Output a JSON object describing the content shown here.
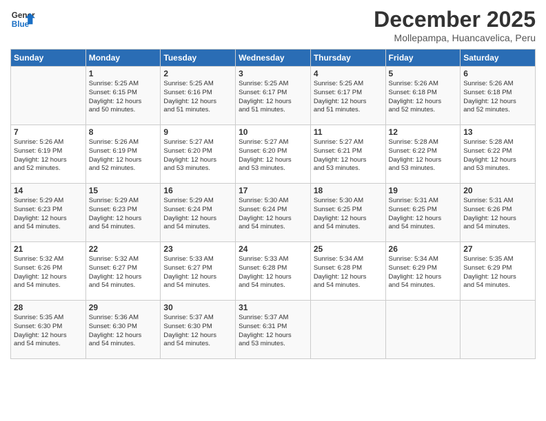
{
  "logo": {
    "line1": "General",
    "line2": "Blue"
  },
  "title": "December 2025",
  "location": "Mollepampa, Huancavelica, Peru",
  "days_of_week": [
    "Sunday",
    "Monday",
    "Tuesday",
    "Wednesday",
    "Thursday",
    "Friday",
    "Saturday"
  ],
  "weeks": [
    [
      {
        "day": "",
        "text": ""
      },
      {
        "day": "1",
        "text": "Sunrise: 5:25 AM\nSunset: 6:15 PM\nDaylight: 12 hours\nand 50 minutes."
      },
      {
        "day": "2",
        "text": "Sunrise: 5:25 AM\nSunset: 6:16 PM\nDaylight: 12 hours\nand 51 minutes."
      },
      {
        "day": "3",
        "text": "Sunrise: 5:25 AM\nSunset: 6:17 PM\nDaylight: 12 hours\nand 51 minutes."
      },
      {
        "day": "4",
        "text": "Sunrise: 5:25 AM\nSunset: 6:17 PM\nDaylight: 12 hours\nand 51 minutes."
      },
      {
        "day": "5",
        "text": "Sunrise: 5:26 AM\nSunset: 6:18 PM\nDaylight: 12 hours\nand 52 minutes."
      },
      {
        "day": "6",
        "text": "Sunrise: 5:26 AM\nSunset: 6:18 PM\nDaylight: 12 hours\nand 52 minutes."
      }
    ],
    [
      {
        "day": "7",
        "text": "Sunrise: 5:26 AM\nSunset: 6:19 PM\nDaylight: 12 hours\nand 52 minutes."
      },
      {
        "day": "8",
        "text": "Sunrise: 5:26 AM\nSunset: 6:19 PM\nDaylight: 12 hours\nand 52 minutes."
      },
      {
        "day": "9",
        "text": "Sunrise: 5:27 AM\nSunset: 6:20 PM\nDaylight: 12 hours\nand 53 minutes."
      },
      {
        "day": "10",
        "text": "Sunrise: 5:27 AM\nSunset: 6:20 PM\nDaylight: 12 hours\nand 53 minutes."
      },
      {
        "day": "11",
        "text": "Sunrise: 5:27 AM\nSunset: 6:21 PM\nDaylight: 12 hours\nand 53 minutes."
      },
      {
        "day": "12",
        "text": "Sunrise: 5:28 AM\nSunset: 6:22 PM\nDaylight: 12 hours\nand 53 minutes."
      },
      {
        "day": "13",
        "text": "Sunrise: 5:28 AM\nSunset: 6:22 PM\nDaylight: 12 hours\nand 53 minutes."
      }
    ],
    [
      {
        "day": "14",
        "text": "Sunrise: 5:29 AM\nSunset: 6:23 PM\nDaylight: 12 hours\nand 54 minutes."
      },
      {
        "day": "15",
        "text": "Sunrise: 5:29 AM\nSunset: 6:23 PM\nDaylight: 12 hours\nand 54 minutes."
      },
      {
        "day": "16",
        "text": "Sunrise: 5:29 AM\nSunset: 6:24 PM\nDaylight: 12 hours\nand 54 minutes."
      },
      {
        "day": "17",
        "text": "Sunrise: 5:30 AM\nSunset: 6:24 PM\nDaylight: 12 hours\nand 54 minutes."
      },
      {
        "day": "18",
        "text": "Sunrise: 5:30 AM\nSunset: 6:25 PM\nDaylight: 12 hours\nand 54 minutes."
      },
      {
        "day": "19",
        "text": "Sunrise: 5:31 AM\nSunset: 6:25 PM\nDaylight: 12 hours\nand 54 minutes."
      },
      {
        "day": "20",
        "text": "Sunrise: 5:31 AM\nSunset: 6:26 PM\nDaylight: 12 hours\nand 54 minutes."
      }
    ],
    [
      {
        "day": "21",
        "text": "Sunrise: 5:32 AM\nSunset: 6:26 PM\nDaylight: 12 hours\nand 54 minutes."
      },
      {
        "day": "22",
        "text": "Sunrise: 5:32 AM\nSunset: 6:27 PM\nDaylight: 12 hours\nand 54 minutes."
      },
      {
        "day": "23",
        "text": "Sunrise: 5:33 AM\nSunset: 6:27 PM\nDaylight: 12 hours\nand 54 minutes."
      },
      {
        "day": "24",
        "text": "Sunrise: 5:33 AM\nSunset: 6:28 PM\nDaylight: 12 hours\nand 54 minutes."
      },
      {
        "day": "25",
        "text": "Sunrise: 5:34 AM\nSunset: 6:28 PM\nDaylight: 12 hours\nand 54 minutes."
      },
      {
        "day": "26",
        "text": "Sunrise: 5:34 AM\nSunset: 6:29 PM\nDaylight: 12 hours\nand 54 minutes."
      },
      {
        "day": "27",
        "text": "Sunrise: 5:35 AM\nSunset: 6:29 PM\nDaylight: 12 hours\nand 54 minutes."
      }
    ],
    [
      {
        "day": "28",
        "text": "Sunrise: 5:35 AM\nSunset: 6:30 PM\nDaylight: 12 hours\nand 54 minutes."
      },
      {
        "day": "29",
        "text": "Sunrise: 5:36 AM\nSunset: 6:30 PM\nDaylight: 12 hours\nand 54 minutes."
      },
      {
        "day": "30",
        "text": "Sunrise: 5:37 AM\nSunset: 6:30 PM\nDaylight: 12 hours\nand 54 minutes."
      },
      {
        "day": "31",
        "text": "Sunrise: 5:37 AM\nSunset: 6:31 PM\nDaylight: 12 hours\nand 53 minutes."
      },
      {
        "day": "",
        "text": ""
      },
      {
        "day": "",
        "text": ""
      },
      {
        "day": "",
        "text": ""
      }
    ]
  ]
}
